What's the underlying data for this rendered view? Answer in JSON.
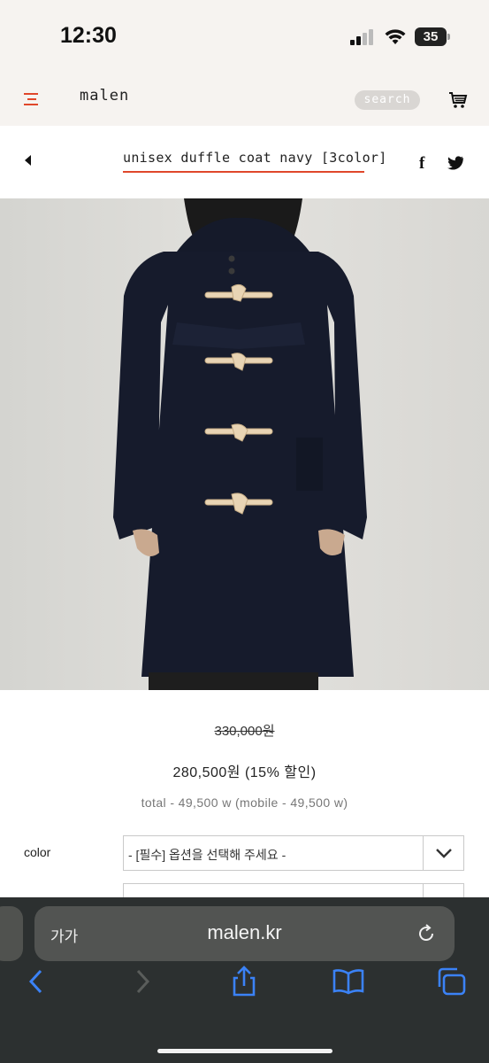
{
  "status_bar": {
    "time": "12:30",
    "battery": "35",
    "icons": [
      "signal-icon",
      "wifi-icon",
      "battery-icon"
    ]
  },
  "site_header": {
    "logo": "malen",
    "search_label": "search",
    "icons": [
      "hamburger-menu-icon",
      "cart-icon"
    ],
    "accent_color": "#e0472b"
  },
  "product": {
    "title": "unisex duffle coat navy [3color]",
    "original_price": "330,000원",
    "sale_price_line": "280,500원 (15% 할인)",
    "total_line": "total - 49,500 w (mobile - 49,500 w)",
    "share_icons": [
      "facebook-icon",
      "twitter-icon"
    ]
  },
  "options": {
    "color_label": "color",
    "color_placeholder": "- [필수] 옵션을 선택해 주세요 -"
  },
  "browser": {
    "text_size_label": "가가",
    "url": "malen.kr",
    "toolbar_icons": [
      "back-icon",
      "forward-icon",
      "share-icon",
      "bookmarks-icon",
      "tabs-icon",
      "reload-icon"
    ]
  }
}
